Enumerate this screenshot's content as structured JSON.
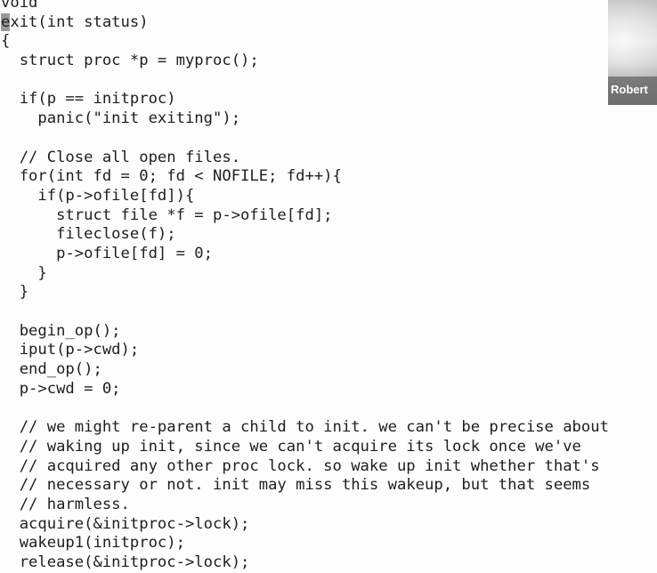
{
  "editor": {
    "cursor_char": "e",
    "code_lines": [
      "void",
      "xit(int status)",
      "{",
      "  struct proc *p = myproc();",
      "",
      "  if(p == initproc)",
      "    panic(\"init exiting\");",
      "",
      "  // Close all open files.",
      "  for(int fd = 0; fd < NOFILE; fd++){",
      "    if(p->ofile[fd]){",
      "      struct file *f = p->ofile[fd];",
      "      fileclose(f);",
      "      p->ofile[fd] = 0;",
      "    }",
      "  }",
      "",
      "  begin_op();",
      "  iput(p->cwd);",
      "  end_op();",
      "  p->cwd = 0;",
      "",
      "  // we might re-parent a child to init. we can't be precise about",
      "  // waking up init, since we can't acquire its lock once we've",
      "  // acquired any other proc lock. so wake up init whether that's",
      "  // necessary or not. init may miss this wakeup, but that seems",
      "  // harmless.",
      "  acquire(&initproc->lock);",
      "  wakeup1(initproc);",
      "  release(&initproc->lock);"
    ]
  },
  "webcam": {
    "participant_name": "Robert"
  }
}
